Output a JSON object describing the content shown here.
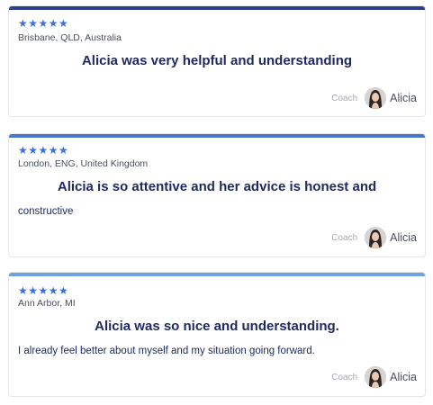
{
  "reviews": [
    {
      "stars": "★★★★★",
      "location": "Brisbane, QLD, Australia",
      "headline": "Alicia was very helpful and understanding",
      "body": "",
      "coach_label": "Coach",
      "coach_name": "Alicia",
      "accent": "#2d3e8a"
    },
    {
      "stars": "★★★★★",
      "location": "London, ENG, United Kingdom",
      "headline": "Alicia is so attentive and her advice is honest and",
      "body": "constructive",
      "coach_label": "Coach",
      "coach_name": "Alicia",
      "accent": "#4a78c8"
    },
    {
      "stars": "★★★★★",
      "location": "Ann Arbor, MI",
      "headline": "Alicia was so nice and understanding.",
      "body": "I already feel better about myself and my situation going forward.",
      "coach_label": "Coach",
      "coach_name": "Alicia",
      "accent": "#6ea4de"
    }
  ],
  "icons": {
    "star": "star-icon",
    "avatar": "avatar-icon"
  }
}
